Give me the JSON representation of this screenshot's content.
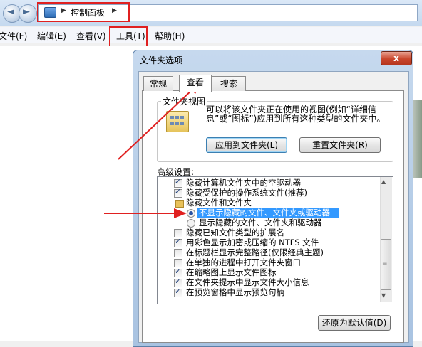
{
  "explorer": {
    "nav_back_glyph": "◄",
    "nav_fwd_glyph": "►",
    "breadcrumb_sep_glyph": "▶",
    "breadcrumb": "控制面板",
    "menu": {
      "file": "文件(F)",
      "edit": "编辑(E)",
      "view": "查看(V)",
      "tools": "工具(T)",
      "help": "帮助(H)"
    }
  },
  "dialog": {
    "title": "文件夹选项",
    "close_glyph": "x",
    "tabs": [
      "常规",
      "查看",
      "搜索"
    ],
    "active_tab": "查看",
    "folder_view": {
      "group_label": "文件夹视图",
      "description": "可以将该文件夹正在使用的视图(例如“详细信息”或“图标”)应用到所有这种类型的文件夹中。",
      "apply_button": "应用到文件夹(L)",
      "reset_button": "重置文件夹(R)"
    },
    "advanced": {
      "label": "高级设置:",
      "items": [
        {
          "kind": "checkbox",
          "checked": true,
          "text": "隐藏计算机文件夹中的空驱动器"
        },
        {
          "kind": "checkbox",
          "checked": true,
          "text": "隐藏受保护的操作系统文件(推荐)"
        },
        {
          "kind": "folder",
          "text": "隐藏文件和文件夹"
        },
        {
          "kind": "radio",
          "checked": true,
          "selected": true,
          "text": "不显示隐藏的文件、文件夹或驱动器"
        },
        {
          "kind": "radio",
          "checked": false,
          "text": "显示隐藏的文件、文件夹和驱动器"
        },
        {
          "kind": "checkbox",
          "checked": false,
          "text": "隐藏已知文件类型的扩展名"
        },
        {
          "kind": "checkbox",
          "checked": true,
          "text": "用彩色显示加密或压缩的 NTFS 文件"
        },
        {
          "kind": "checkbox",
          "checked": false,
          "text": "在标题栏显示完整路径(仅限经典主题)"
        },
        {
          "kind": "checkbox",
          "checked": false,
          "text": "在单独的进程中打开文件夹窗口"
        },
        {
          "kind": "checkbox",
          "checked": true,
          "text": "在缩略图上显示文件图标"
        },
        {
          "kind": "checkbox",
          "checked": true,
          "text": "在文件夹提示中显示文件大小信息"
        },
        {
          "kind": "checkbox",
          "checked": true,
          "text": "在预览窗格中显示预览句柄"
        }
      ],
      "restore_button": "还原为默认值(D)"
    }
  },
  "colors": {
    "annotation_red": "#e02020",
    "selection_blue": "#3399ff"
  }
}
